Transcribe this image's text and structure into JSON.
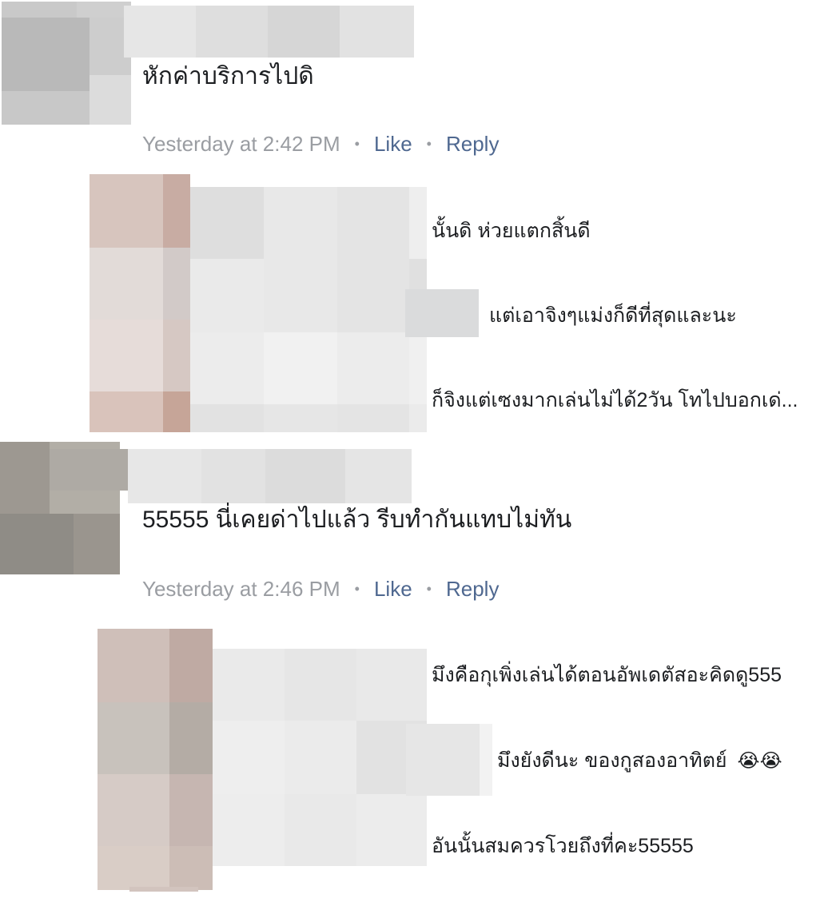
{
  "comments": [
    {
      "text": "หักค่าบริการไปดิ",
      "timestamp": "Yesterday at 2:42 PM",
      "like_label": "Like",
      "reply_label": "Reply",
      "separator": "•",
      "replies": [
        {
          "text": "นั้นดิ ห่วยแตกสิ้นดี"
        },
        {
          "text": "แต่เอาจิงๆแม่งก็ดีที่สุดและนะ"
        },
        {
          "text": "ก็จิงแต่เซงมากเล่นไม่ได้2วัน โทไปบอกเด่..."
        }
      ]
    },
    {
      "text": "55555 นี่เคยด่าไปแล้ว รีบทำกันแทบไม่ทัน",
      "timestamp": "Yesterday at 2:46 PM",
      "like_label": "Like",
      "reply_label": "Reply",
      "separator": "•",
      "replies": [
        {
          "text": "มึงคือกุเพิ่งเล่นได้ตอนอัพเดตัสอะคิดดู555"
        },
        {
          "text": "มึงยังดีนะ ของกูสองอาทิตย์",
          "emoji": "😭😭"
        },
        {
          "text": "อันนั้นสมควรโวยถึงที่คะ55555"
        }
      ]
    }
  ],
  "colors": {
    "timestamp": "#9a9da2",
    "link": "#4f6890",
    "text": "#1c1e21"
  }
}
